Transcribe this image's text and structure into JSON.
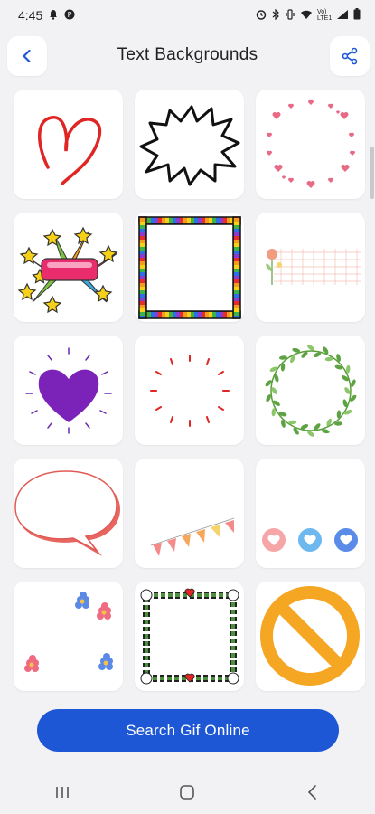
{
  "status_bar": {
    "time": "4:45",
    "network_label": "Vo) LTE1",
    "icons": [
      "notification-icon",
      "app-icon",
      "alarm-icon",
      "bluetooth-icon",
      "vibrate-icon",
      "wifi-icon",
      "signal-icon",
      "battery-icon"
    ]
  },
  "header": {
    "title": "Text Backgrounds",
    "back_icon": "chevron-left-icon",
    "share_icon": "share-icon"
  },
  "backgrounds": [
    {
      "name": "red-heart-scribble"
    },
    {
      "name": "black-burst-outline"
    },
    {
      "name": "pink-hearts-circle"
    },
    {
      "name": "stars-banner-burst"
    },
    {
      "name": "rainbow-square-frame"
    },
    {
      "name": "flower-grid-paper"
    },
    {
      "name": "purple-heart-rays"
    },
    {
      "name": "red-dash-circle"
    },
    {
      "name": "green-leaf-wreath"
    },
    {
      "name": "speech-bubble-red"
    },
    {
      "name": "pennant-bunting"
    },
    {
      "name": "three-heart-circles"
    },
    {
      "name": "scattered-flowers"
    },
    {
      "name": "leafy-square-frame"
    },
    {
      "name": "orange-no-sign"
    }
  ],
  "cta": {
    "label": "Search Gif Online"
  },
  "colors": {
    "accent": "#1d57d6",
    "background": "#f2f2f4"
  }
}
